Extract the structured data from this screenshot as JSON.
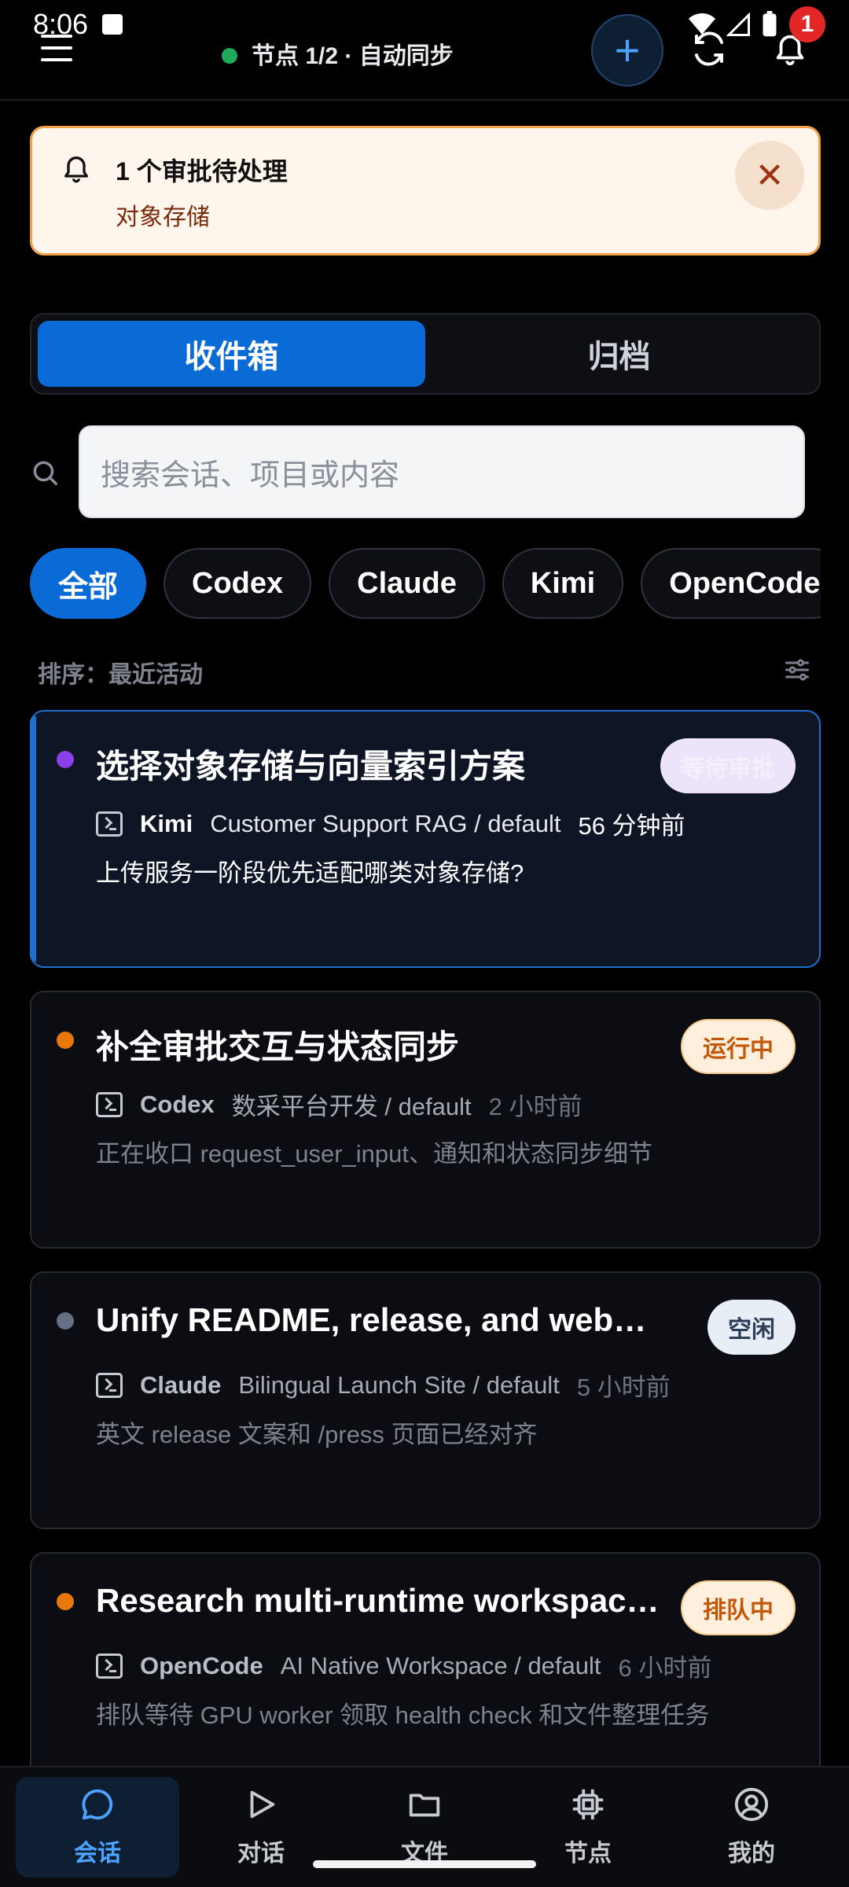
{
  "status_bar": {
    "time": "8:06",
    "notification_count": "1"
  },
  "header": {
    "node_status": "节点 1/2 · 自动同步"
  },
  "approval_banner": {
    "title": "1 个审批待处理",
    "subtitle": "对象存储"
  },
  "segment_tabs": [
    {
      "label": "收件箱",
      "active": true
    },
    {
      "label": "归档",
      "active": false
    }
  ],
  "search": {
    "placeholder": "搜索会话、项目或内容"
  },
  "filters": [
    {
      "label": "全部",
      "active": true
    },
    {
      "label": "Codex",
      "active": false
    },
    {
      "label": "Claude",
      "active": false
    },
    {
      "label": "Kimi",
      "active": false
    },
    {
      "label": "OpenCode",
      "active": false
    }
  ],
  "sort": {
    "label": "排序：最近活动"
  },
  "sessions": [
    {
      "title": "选择对象存储与向量索引方案",
      "status": "等待审批",
      "dot_color": "#8b3fe6",
      "runtime": "Kimi",
      "project": "Customer Support RAG / default",
      "time": "56 分钟前",
      "preview": "上传服务一阶段优先适配哪类对象存储?"
    },
    {
      "title": "补全审批交互与状态同步",
      "status": "运行中",
      "dot_color": "#e8780c",
      "runtime": "Codex",
      "project": "数采平台开发 / default",
      "time": "2 小时前",
      "preview": "正在收口 request_user_input、通知和状态同步细节"
    },
    {
      "title": "Unify README, release, and website c...",
      "status": "空闲",
      "dot_color": "#667085",
      "runtime": "Claude",
      "project": "Bilingual Launch Site / default",
      "time": "5 小时前",
      "preview": "英文 release 文案和 /press 页面已经对齐"
    },
    {
      "title": "Research multi-runtime workspace ...",
      "status": "排队中",
      "dot_color": "#e8780c",
      "runtime": "OpenCode",
      "project": "AI Native Workspace / default",
      "time": "6 小时前",
      "preview": "排队等待 GPU worker 领取 health check 和文件整理任务"
    }
  ],
  "bottom_nav": [
    {
      "label": "会话",
      "icon": "chat-bubble-icon",
      "active": true
    },
    {
      "label": "对话",
      "icon": "play-icon",
      "active": false
    },
    {
      "label": "文件",
      "icon": "folder-icon",
      "active": false
    },
    {
      "label": "节点",
      "icon": "chip-icon",
      "active": false
    },
    {
      "label": "我的",
      "icon": "user-circle-icon",
      "active": false
    }
  ],
  "colors": {
    "accent": "#0b6bd6",
    "banner_bg": "#fef6ec",
    "banner_border": "#f1a04a",
    "status_waiting": "#ede4fb",
    "status_running": "#fff0dd",
    "status_idle": "#e8eef5",
    "status_queued": "#fff0dd"
  }
}
